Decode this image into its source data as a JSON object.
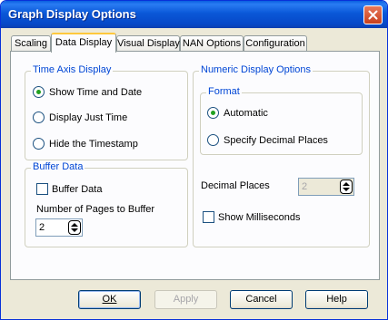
{
  "window": {
    "title": "Graph Display Options"
  },
  "tabs": [
    {
      "label": "Scaling"
    },
    {
      "label": "Data Display"
    },
    {
      "label": "Visual Display"
    },
    {
      "label": "NAN Options"
    },
    {
      "label": "Configuration"
    }
  ],
  "time_axis": {
    "title": "Time Axis Display",
    "options": [
      {
        "label": "Show Time and Date",
        "selected": true
      },
      {
        "label": "Display Just Time",
        "selected": false
      },
      {
        "label": "Hide the Timestamp",
        "selected": false
      }
    ]
  },
  "buffer": {
    "title": "Buffer Data",
    "checkbox_label": "Buffer Data",
    "checked": false,
    "pages_label": "Number of Pages to Buffer",
    "pages_value": "2"
  },
  "numeric": {
    "title": "Numeric Display Options",
    "format": {
      "title": "Format",
      "options": [
        {
          "label": "Automatic",
          "selected": true
        },
        {
          "label": "Specify Decimal Places",
          "selected": false
        }
      ]
    },
    "decimal_label": "Decimal Places",
    "decimal_value": "2",
    "millis_label": "Show Milliseconds",
    "millis_checked": false
  },
  "buttons": {
    "ok": "OK",
    "apply": "Apply",
    "cancel": "Cancel",
    "help": "Help"
  },
  "icons": {
    "close": "close-icon",
    "spin": "spin-updown-icon"
  }
}
